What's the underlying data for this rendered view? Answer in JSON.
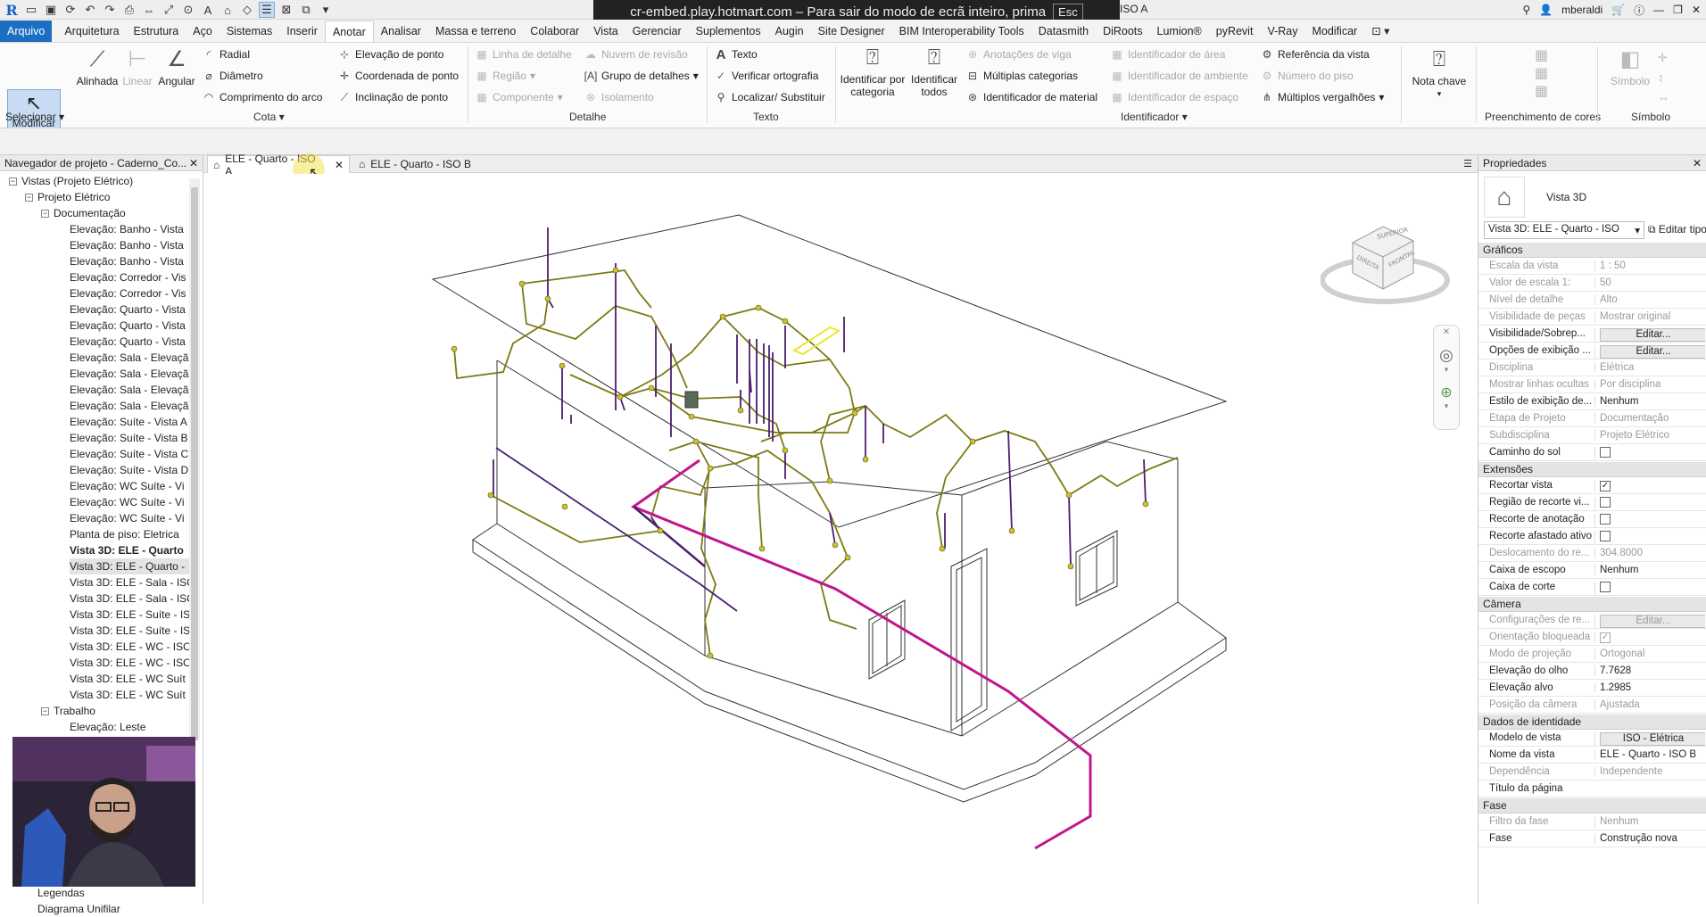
{
  "banner": {
    "text": "cr-embed.play.hotmart.com – Para sair do modo de ecrã inteiro, prima",
    "key": "Esc"
  },
  "titlebar": {
    "doc_suffix": "ISO A",
    "user": "mberaldi"
  },
  "tabs": [
    "Arquivo",
    "Arquitetura",
    "Estrutura",
    "Aço",
    "Sistemas",
    "Inserir",
    "Anotar",
    "Analisar",
    "Massa e terreno",
    "Colaborar",
    "Vista",
    "Gerenciar",
    "Suplementos",
    "Augin",
    "Site Designer",
    "BIM Interoperability Tools",
    "Datasmith",
    "DiRoots",
    "Lumion®",
    "pyRevit",
    "V-Ray",
    "Modificar"
  ],
  "ribbon": {
    "modificar": "Modificar",
    "selecionar": "Selecionar",
    "alinhada": "Alinhada",
    "linear": "Linear",
    "angular": "Angular",
    "radial": "Radial",
    "diametro": "Diâmetro",
    "comprimento_arco": "Comprimento do arco",
    "elevacao_ponto": "Elevação de ponto",
    "coordenada_ponto": "Coordenada de ponto",
    "inclinacao_ponto": "Inclinação de ponto",
    "cota": "Cota",
    "linha_detalhe": "Linha de detalhe",
    "regiao": "Região",
    "componente": "Componente",
    "nuvem_revisao": "Nuvem de revisão",
    "grupo_detalhes": "Grupo de detalhes",
    "isolamento": "Isolamento",
    "detalhe": "Detalhe",
    "texto_btn": "Texto",
    "verificar_ortografia": "Verificar ortografia",
    "localizar": "Localizar/ Substituir",
    "texto": "Texto",
    "id_categoria_1": "Identificar por",
    "id_categoria_2": "categoria",
    "id_todos_1": "Identificar",
    "id_todos_2": "todos",
    "anotacoes_viga": "Anotações de viga",
    "multiplas_categorias": "Múltiplas categorias",
    "id_material": "Identificador de material",
    "id_area": "Identificador de área",
    "id_ambiente": "Identificador de ambiente",
    "id_espaco": "Identificador de espaço",
    "referencia_vista": "Referência da vista",
    "numero_piso": "Número do piso",
    "multiplos_vergalhoes": "Múltiplos vergalhões",
    "identificador": "Identificador",
    "nota_chave": "Nota chave",
    "preenchimento": "Preenchimento de cores",
    "simbolo_btn": "Símbolo",
    "simbolo": "Símbolo"
  },
  "project_browser": {
    "title": "Navegador de projeto - Caderno_Co...",
    "root": "Vistas (Projeto Elétrico)",
    "group": "Projeto Elétrico",
    "subgroup": "Documentação",
    "items": [
      "Elevação: Banho - Vista",
      "Elevação: Banho - Vista",
      "Elevação: Banho - Vista",
      "Elevação: Corredor - Vis",
      "Elevação: Corredor - Vis",
      "Elevação: Quarto - Vista",
      "Elevação: Quarto - Vista",
      "Elevação: Quarto - Vista",
      "Elevação: Sala - Elevaçã",
      "Elevação: Sala - Elevaçã",
      "Elevação: Sala - Elevaçã",
      "Elevação: Sala - Elevaçã",
      "Elevação: Suíte - Vista A",
      "Elevação: Suíte - Vista B",
      "Elevação: Suíte - Vista C",
      "Elevação: Suíte - Vista D",
      "Elevação: WC Suíte - Vi",
      "Elevação: WC Suíte - Vi",
      "Elevação: WC Suíte - Vi",
      "Planta de piso: Eletrica",
      "Vista 3D: ELE - Quarto",
      "Vista 3D: ELE - Quarto -",
      "Vista 3D: ELE - Sala - ISO",
      "Vista 3D: ELE - Sala - ISO",
      "Vista 3D: ELE - Suíte - IS",
      "Vista 3D: ELE - Suíte - IS",
      "Vista 3D: ELE - WC - ISO",
      "Vista 3D: ELE - WC - ISO",
      "Vista 3D: ELE - WC Suít",
      "Vista 3D: ELE - WC Suít"
    ],
    "group2": "Trabalho",
    "item2": "Elevação: Leste",
    "legendas": "Legendas",
    "diagrama": "Diagrama Unifilar"
  },
  "view_tabs": [
    {
      "label": "ELE - Quarto - ISO A",
      "active": true
    },
    {
      "label": "ELE - Quarto - ISO B",
      "active": false
    }
  ],
  "properties": {
    "title": "Propriedades",
    "type": "Vista 3D",
    "selector": "Vista 3D: ELE - Quarto - ISO",
    "edit_type": "Editar tipo",
    "sections": [
      {
        "name": "Gráficos",
        "rows": [
          {
            "k": "Escala da vista",
            "v": "1 : 50",
            "dis": true
          },
          {
            "k": "Valor de escala    1:",
            "v": "50",
            "dis": true
          },
          {
            "k": "Nível de detalhe",
            "v": "Alto",
            "dis": true
          },
          {
            "k": "Visibilidade de peças",
            "v": "Mostrar original",
            "dis": true
          },
          {
            "k": "Visibilidade/Sobrep...",
            "v": "Editar...",
            "btn": true
          },
          {
            "k": "Opções de exibição ...",
            "v": "Editar...",
            "btn": true
          },
          {
            "k": "Disciplina",
            "v": "Elétrica",
            "dis": true
          },
          {
            "k": "Mostrar linhas ocultas",
            "v": "Por disciplina",
            "dis": true
          },
          {
            "k": "Estilo de exibição de...",
            "v": "Nenhum"
          },
          {
            "k": "Etapa de Projeto",
            "v": "Documentação",
            "dis": true
          },
          {
            "k": "Subdisciplina",
            "v": "Projeto Elétrico",
            "dis": true
          },
          {
            "k": "Caminho do sol",
            "v": "",
            "chk": false
          }
        ]
      },
      {
        "name": "Extensões",
        "rows": [
          {
            "k": "Recortar vista",
            "v": "",
            "chk": true
          },
          {
            "k": "Região de recorte vi...",
            "v": "",
            "chk": false
          },
          {
            "k": "Recorte de anotação",
            "v": "",
            "chk": false
          },
          {
            "k": "Recorte afastado ativo",
            "v": "",
            "chk": false
          },
          {
            "k": "Deslocamento do re...",
            "v": "304.8000",
            "dis": true
          },
          {
            "k": "Caixa de escopo",
            "v": "Nenhum"
          },
          {
            "k": "Caixa de corte",
            "v": "",
            "chk": false
          }
        ]
      },
      {
        "name": "Câmera",
        "rows": [
          {
            "k": "Configurações de re...",
            "v": "Editar...",
            "btn": true,
            "dis": true
          },
          {
            "k": "Orientação bloqueada",
            "v": "",
            "chk": true,
            "dis": true
          },
          {
            "k": "Modo de projeção",
            "v": "Ortogonal",
            "dis": true
          },
          {
            "k": "Elevação do olho",
            "v": "7.7628"
          },
          {
            "k": "Elevação alvo",
            "v": "1.2985"
          },
          {
            "k": "Posição da câmera",
            "v": "Ajustada",
            "dis": true
          }
        ]
      },
      {
        "name": "Dados de identidade",
        "rows": [
          {
            "k": "Modelo de vista",
            "v": "ISO - Elétrica",
            "btn": true
          },
          {
            "k": "Nome da vista",
            "v": "ELE - Quarto - ISO B"
          },
          {
            "k": "Dependência",
            "v": "Independente",
            "dis": true
          },
          {
            "k": "Título da página",
            "v": ""
          }
        ]
      },
      {
        "name": "Fase",
        "rows": [
          {
            "k": "Filtro da fase",
            "v": "Nenhum",
            "dis": true
          },
          {
            "k": "Fase",
            "v": "Construção nova"
          }
        ]
      }
    ]
  },
  "viewcube": {
    "top": "SUPERIOR",
    "front": "FRONTAL",
    "right": "DIREITA"
  },
  "colors": {
    "accent": "#1b6ec2",
    "wire_olive": "#7d7a14",
    "wire_purple": "#4a1f6e",
    "conduit_magenta": "#c0168b",
    "highlight": "#e8e832"
  }
}
